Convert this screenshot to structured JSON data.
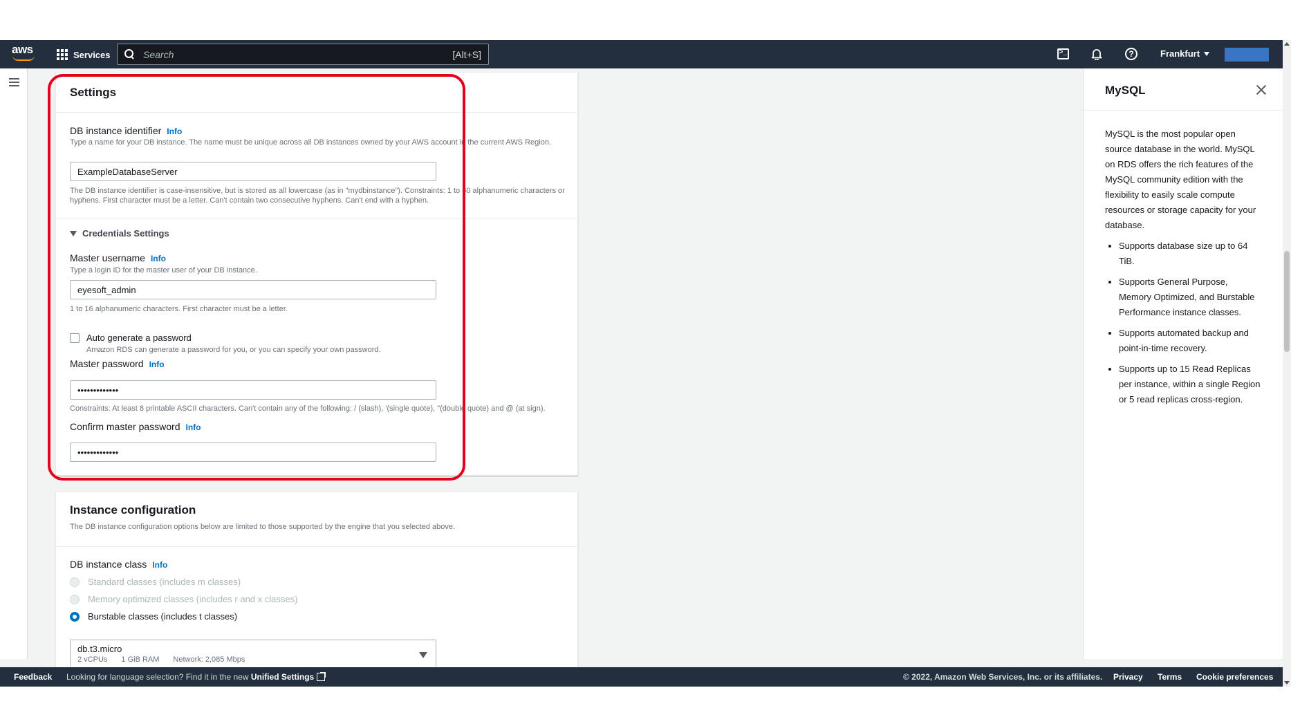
{
  "topnav": {
    "logo_text": "aws",
    "services_label": "Services",
    "search_placeholder": "Search",
    "search_shortcut": "[Alt+S]",
    "help_glyph": "?",
    "region_label": "Frankfurt"
  },
  "settings": {
    "title": "Settings",
    "db_identifier": {
      "label": "DB instance identifier",
      "info": "Info",
      "description": "Type a name for your DB instance. The name must be unique across all DB instances owned by your AWS account in the current AWS Region.",
      "value": "ExampleDatabaseServer",
      "constraints": "The DB instance identifier is case-insensitive, but is stored as all lowercase (as in \"mydbinstance\"). Constraints: 1 to 60 alphanumeric characters or hyphens. First character must be a letter. Can't contain two consecutive hyphens. Can't end with a hyphen."
    },
    "credentials": {
      "section_title": "Credentials Settings",
      "master_username": {
        "label": "Master username",
        "info": "Info",
        "description": "Type a login ID for the master user of your DB instance.",
        "value": "eyesoft_admin",
        "constraints": "1 to 16 alphanumeric characters. First character must be a letter."
      },
      "auto_generate": {
        "label": "Auto generate a password",
        "description": "Amazon RDS can generate a password for you, or you can specify your own password.",
        "checked": false
      },
      "master_password": {
        "label": "Master password",
        "info": "Info",
        "value": "•••••••••••••",
        "constraints": "Constraints: At least 8 printable ASCII characters. Can't contain any of the following: / (slash), '(single quote), \"(double quote) and @ (at sign)."
      },
      "confirm_password": {
        "label": "Confirm master password",
        "info": "Info",
        "value": "•••••••••••••"
      }
    }
  },
  "instance_config": {
    "title": "Instance configuration",
    "description": "The DB instance configuration options below are limited to those supported by the engine that you selected above.",
    "db_class": {
      "label": "DB instance class",
      "info": "Info",
      "options": [
        {
          "label": "Standard classes (includes m classes)",
          "selected": false,
          "disabled": true
        },
        {
          "label": "Memory optimized classes (includes r and x classes)",
          "selected": false,
          "disabled": true
        },
        {
          "label": "Burstable classes (includes t classes)",
          "selected": true,
          "disabled": false
        }
      ],
      "selected_class": "db.t3.micro",
      "specs": [
        "2 vCPUs",
        "1 GiB RAM",
        "Network: 2,085 Mbps"
      ]
    }
  },
  "help_panel": {
    "title": "MySQL",
    "intro": "MySQL is the most popular open source database in the world. MySQL on RDS offers the rich features of the MySQL community edition with the flexibility to easily scale compute resources or storage capacity for your database.",
    "bullets": [
      "Supports database size up to 64 TiB.",
      "Supports General Purpose, Memory Optimized, and Burstable Performance instance classes.",
      "Supports automated backup and point-in-time recovery.",
      "Supports up to 15 Read Replicas per instance, within a single Region or 5 read replicas cross-region."
    ]
  },
  "footer": {
    "feedback": "Feedback",
    "language_message": "Looking for language selection? Find it in the new",
    "unified_settings": "Unified Settings",
    "copyright": "© 2022, Amazon Web Services, Inc. or its affiliates.",
    "privacy": "Privacy",
    "terms": "Terms",
    "cookie_preferences": "Cookie preferences"
  },
  "colors": {
    "nav_background": "#232f3e",
    "link": "#0073bb",
    "highlight": "#e5001c",
    "account_block": "#3a75c4"
  }
}
